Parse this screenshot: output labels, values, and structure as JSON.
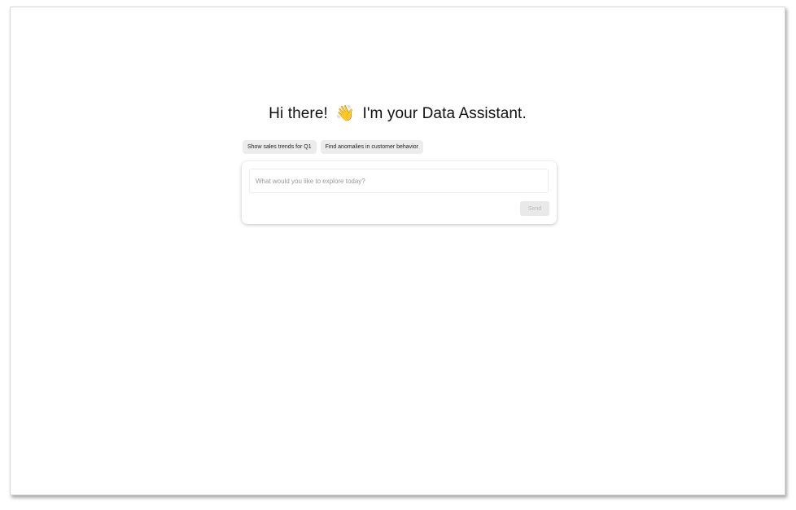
{
  "greeting": {
    "lead": "Hi there!",
    "emoji": "👋",
    "rest": "I'm your Data Assistant."
  },
  "suggestions": [
    {
      "label": "Show sales trends for Q1"
    },
    {
      "label": "Find anomalies in customer behavior"
    }
  ],
  "composer": {
    "placeholder": "What would you like to explore today?",
    "value": "",
    "send_label": "Send",
    "send_enabled": false
  },
  "colors": {
    "chip_bg": "#ececec",
    "send_disabled_bg": "#e9e9e9",
    "send_disabled_text": "#b8b8b8"
  }
}
